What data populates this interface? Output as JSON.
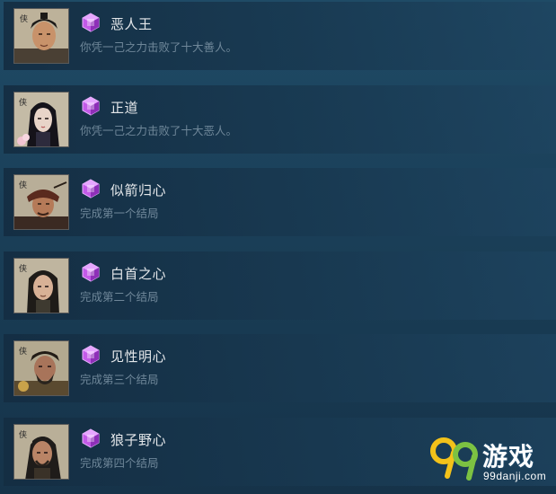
{
  "achievements": [
    {
      "title": "恶人王",
      "description": "你凭一己之力击败了十大善人。",
      "icon": "gem-icon",
      "portrait": "warrior-portrait-1"
    },
    {
      "title": "正道",
      "description": "你凭一己之力击败了十大恶人。",
      "icon": "gem-icon",
      "portrait": "maiden-portrait"
    },
    {
      "title": "似箭归心",
      "description": "完成第一个结局",
      "icon": "gem-icon",
      "portrait": "hat-warrior-portrait"
    },
    {
      "title": "白首之心",
      "description": "完成第二个结局",
      "icon": "gem-icon",
      "portrait": "longhair-warrior-portrait"
    },
    {
      "title": "见性明心",
      "description": "完成第三个结局",
      "icon": "gem-icon",
      "portrait": "bearded-warrior-portrait"
    },
    {
      "title": "狼子野心",
      "description": "完成第四个结局",
      "icon": "gem-icon",
      "portrait": "scarred-warrior-portrait"
    }
  ],
  "watermark": {
    "brand": "游戏",
    "url": "99danji.com",
    "logo": "99-logo"
  },
  "colors": {
    "title": "#e4e7ea",
    "description": "#6f8799",
    "gem": "#b54de0"
  }
}
